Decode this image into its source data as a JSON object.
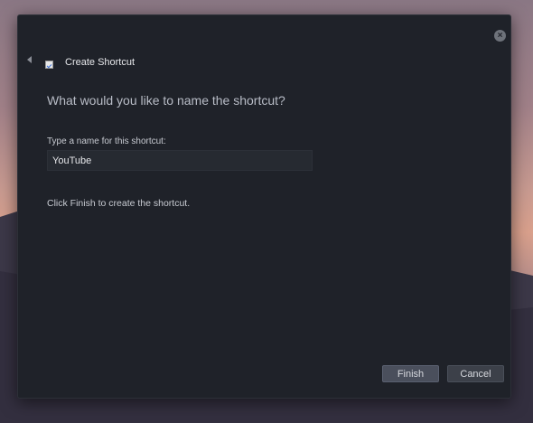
{
  "dialog": {
    "title": "Create Shortcut",
    "close_icon": "close-icon",
    "back_icon": "back-arrow-icon",
    "app_icon": "shortcut-icon",
    "heading": "What would you like to name the shortcut?",
    "name_field": {
      "label": "Type a name for this shortcut:",
      "value": "YouTube"
    },
    "hint": "Click Finish to create the shortcut.",
    "buttons": {
      "finish": "Finish",
      "cancel": "Cancel"
    }
  },
  "colors": {
    "dialog_bg": "#1f2229",
    "button_bg": "#4a4f5c",
    "text": "#e6e7ea"
  }
}
